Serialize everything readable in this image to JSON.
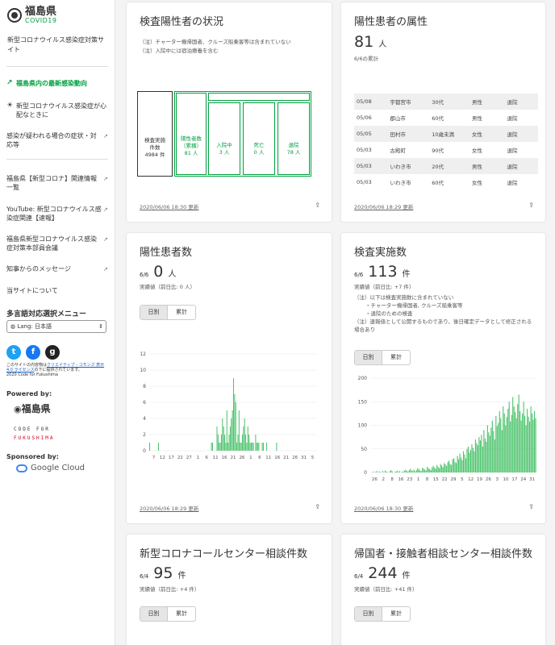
{
  "sidebar": {
    "logo_title": "福島県",
    "logo_sub": "COVID19",
    "site_title": "新型コロナウイルス感染症対策サイト",
    "nav": [
      {
        "icon": "trend-icon",
        "label": "福島県内の最新感染動向",
        "external": false,
        "active": true
      },
      {
        "icon": "sun-icon",
        "label": "新型コロナウイルス感染症が心配なときに",
        "external": false,
        "active": false
      },
      {
        "icon": "",
        "label": "感染が疑われる場合の症状・対応等",
        "external": true,
        "active": false
      },
      {
        "icon": "",
        "label": "福島県【新型コロナ】関連情報一覧",
        "external": true,
        "active": false
      },
      {
        "icon": "",
        "label": "YouTube: 新型コロナウイルス感染症関連【速報】",
        "external": true,
        "active": false
      },
      {
        "icon": "",
        "label": "福島県新型コロナウイルス感染症対策本部員会議",
        "external": true,
        "active": false
      },
      {
        "icon": "",
        "label": "知事からのメッセージ",
        "external": true,
        "active": false
      },
      {
        "icon": "",
        "label": "当サイトについて",
        "external": false,
        "active": false
      }
    ],
    "lang_heading": "多言語対応選択メニュー",
    "lang_value": "Lang: 日本語",
    "license_pre": "このサイトの内容物は",
    "license_link": "クリエイティブ・コモンズ 表示 4.0 ライセンス",
    "license_post": "の下に提供されています。",
    "copyright": "2020 Code for Fukushima",
    "powered_by": "Powered by:",
    "powered_logo": "福島県",
    "cff_line1": "CODE FOR",
    "cff_line2": "FUKUSHIMA",
    "sponsored": "Sponsored by:",
    "sponsor_name": "Google Cloud"
  },
  "common": {
    "daily": "日別",
    "cumulative": "累計"
  },
  "card1": {
    "title": "検査陽性者の状況",
    "note1": "（注）チャーター機帰国者、クルーズ船乗客等は含まれていない",
    "note2": "（注）入院中には宿泊療養を含む",
    "tested_label": "検査実施件数",
    "tested_value": "4984 件",
    "positive_label": "陽性者数（累積）",
    "positive_value": "81 人",
    "hosp_label": "入院中",
    "hosp_value": "3 人",
    "death_label": "死亡",
    "death_value": "0 人",
    "disch_label": "退院",
    "disch_value": "78 人",
    "updated": "2020/06/06 18:30 更新"
  },
  "card2": {
    "title": "陽性患者の属性",
    "number": "81",
    "unit": "人",
    "sub": "6/6の累計",
    "rows": [
      [
        "05/08",
        "宇都宮市",
        "30代",
        "男性",
        "退院"
      ],
      [
        "05/06",
        "郡山市",
        "60代",
        "男性",
        "退院"
      ],
      [
        "05/05",
        "田村市",
        "10歳未満",
        "女性",
        "退院"
      ],
      [
        "05/03",
        "古殿町",
        "90代",
        "女性",
        "退院"
      ],
      [
        "05/03",
        "いわき市",
        "20代",
        "男性",
        "退院"
      ],
      [
        "05/03",
        "いわき市",
        "60代",
        "女性",
        "退院"
      ]
    ],
    "updated": "2020/06/06 18:29 更新"
  },
  "card3": {
    "title": "陽性患者数",
    "date": "6/6",
    "number": "0",
    "unit": "人",
    "sub": "実績値（前日比: 0 人）",
    "updated": "2020/06/06 18:29 更新",
    "chart_data": {
      "type": "bar",
      "ylim": [
        0,
        12
      ],
      "yticks": [
        0,
        2,
        4,
        6,
        8,
        10,
        12
      ],
      "xticks": [
        "7",
        "12",
        "17",
        "22",
        "27",
        "1",
        "6",
        "11",
        "16",
        "21",
        "26",
        "1",
        "6",
        "11",
        "16",
        "21",
        "26",
        "31",
        "5"
      ],
      "values": [
        1,
        0,
        0,
        0,
        0,
        0,
        0,
        0,
        1,
        0,
        0,
        0,
        0,
        0,
        0,
        0,
        0,
        0,
        0,
        0,
        0,
        0,
        0,
        0,
        0,
        0,
        0,
        0,
        0,
        0,
        0,
        0,
        0,
        0,
        0,
        0,
        0,
        0,
        0,
        0,
        0,
        0,
        0,
        0,
        0,
        0,
        0,
        0,
        0,
        0,
        0,
        0,
        0,
        0,
        0,
        0,
        1,
        1,
        0,
        0,
        0,
        3,
        2,
        1,
        1,
        2,
        4,
        3,
        2,
        1,
        5,
        1,
        2,
        3,
        4,
        5,
        9,
        7,
        6,
        1,
        2,
        5,
        1,
        1,
        2,
        3,
        4,
        2,
        1,
        3,
        2,
        1,
        1,
        1,
        1,
        0,
        2,
        1,
        1,
        1,
        0,
        0,
        1,
        1,
        0,
        0,
        1,
        0,
        0,
        0,
        0,
        0,
        0,
        0,
        0,
        1,
        0,
        0,
        0,
        0,
        0,
        0,
        0,
        0,
        0,
        0,
        0,
        0,
        0,
        0,
        0,
        0,
        0,
        0,
        0,
        0,
        0,
        0,
        0,
        0,
        0,
        0,
        0,
        0,
        0,
        0,
        0,
        0,
        0,
        0,
        0,
        0
      ]
    }
  },
  "card4": {
    "title": "検査実施数",
    "date": "6/6",
    "number": "113",
    "unit": "件",
    "sub": "実績値（前日比: +7 件）",
    "notes": [
      "（注）以下は検査実施数に含まれていない",
      "・チャーター機帰国者, クルーズ船乗客等",
      "・退院のための検査",
      "（注）速報値として公開するものであり、後日確定データとして修正される場合あり"
    ],
    "updated": "2020/06/06 18:30 更新",
    "chart_data": {
      "type": "bar",
      "ylim": [
        0,
        200
      ],
      "yticks": [
        0,
        50,
        100,
        150,
        200
      ],
      "xticks": [
        "26",
        "2",
        "8",
        "16",
        "23",
        "1",
        "8",
        "15",
        "22",
        "29",
        "5",
        "12",
        "19",
        "26",
        "3",
        "10",
        "17",
        "24",
        "31"
      ],
      "values": [
        0,
        0,
        2,
        0,
        1,
        3,
        0,
        2,
        1,
        0,
        3,
        0,
        4,
        2,
        1,
        0,
        3,
        5,
        2,
        0,
        1,
        2,
        4,
        1,
        3,
        0,
        2,
        1,
        4,
        6,
        3,
        2,
        5,
        8,
        4,
        3,
        6,
        2,
        5,
        9,
        7,
        4,
        3,
        10,
        8,
        6,
        4,
        12,
        9,
        7,
        5,
        11,
        14,
        10,
        8,
        16,
        12,
        9,
        18,
        15,
        11,
        20,
        17,
        14,
        22,
        25,
        18,
        16,
        28,
        30,
        22,
        20,
        35,
        28,
        40,
        32,
        26,
        45,
        38,
        30,
        50,
        55,
        42,
        48,
        60,
        52,
        45,
        70,
        62,
        58,
        75,
        68,
        80,
        55,
        90,
        72,
        65,
        100,
        85,
        78,
        95,
        110,
        88,
        70,
        120,
        98,
        105,
        130,
        115,
        90,
        140,
        125,
        100,
        118,
        135,
        150,
        108,
        122,
        160,
        140,
        128,
        115,
        145,
        165,
        130,
        110,
        125,
        150,
        120,
        100,
        135,
        118,
        108,
        140,
        125,
        112,
        130,
        115
      ]
    }
  },
  "card5": {
    "title": "新型コロナコールセンター相談件数",
    "date": "6/4",
    "number": "95",
    "unit": "件",
    "sub": "実績値（前日比: +4 件）"
  },
  "card6": {
    "title": "帰国者・接触者相談センター相談件数",
    "date": "6/4",
    "number": "244",
    "unit": "件",
    "sub": "実績値（前日比: +41 件）"
  },
  "colors": {
    "green": "#00a040",
    "bar": "#4ec46e"
  }
}
